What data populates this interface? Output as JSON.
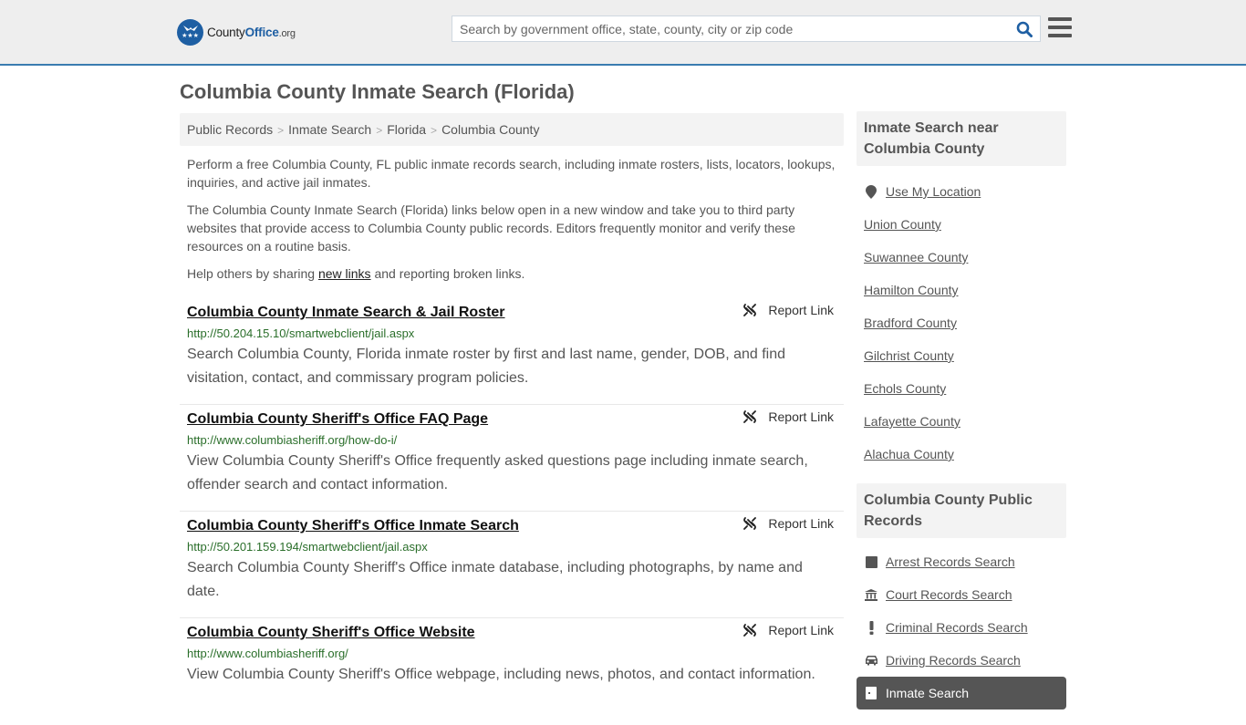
{
  "header": {
    "logo": {
      "text_main": "County",
      "text_accent": "Office",
      "text_suffix": ".org"
    },
    "search": {
      "placeholder": "Search by government office, state, county, city or zip code",
      "value": ""
    },
    "brand_color": "#1e5fa3"
  },
  "page": {
    "title": "Columbia County Inmate Search (Florida)"
  },
  "breadcrumb": [
    {
      "label": "Public Records"
    },
    {
      "label": "Inmate Search"
    },
    {
      "label": "Florida"
    },
    {
      "label": "Columbia County"
    }
  ],
  "intro": {
    "p1": "Perform a free Columbia County, FL public inmate records search, including inmate rosters, lists, locators, lookups, inquiries, and active jail inmates.",
    "p2": "The Columbia County Inmate Search (Florida) links below open in a new window and take you to third party websites that provide access to Columbia County public records. Editors frequently monitor and verify these resources on a routine basis.",
    "p3_before": "Help others by sharing ",
    "p3_link": "new links",
    "p3_after": " and reporting broken links."
  },
  "results": [
    {
      "title": "Columbia County Inmate Search & Jail Roster",
      "url": "http://50.204.15.10/smartwebclient/jail.aspx",
      "description": "Search Columbia County, Florida inmate roster by first and last name, gender, DOB, and find visitation, contact, and commissary program policies.",
      "report_label": "Report Link"
    },
    {
      "title": "Columbia County Sheriff's Office FAQ Page",
      "url": "http://www.columbiasheriff.org/how-do-i/",
      "description": "View Columbia County Sheriff's Office frequently asked questions page including inmate search, offender search and contact information.",
      "report_label": "Report Link"
    },
    {
      "title": "Columbia County Sheriff's Office Inmate Search",
      "url": "http://50.201.159.194/smartwebclient/jail.aspx",
      "description": "Search Columbia County Sheriff's Office inmate database, including photographs, by name and date.",
      "report_label": "Report Link"
    },
    {
      "title": "Columbia County Sheriff's Office Website",
      "url": "http://www.columbiasheriff.org/",
      "description": "View Columbia County Sheriff's Office webpage, including news, photos, and contact information.",
      "report_label": "Report Link"
    }
  ],
  "sidebar": {
    "nearby": {
      "heading": "Inmate Search near Columbia County",
      "use_location": {
        "label": "Use My Location",
        "icon": "map-pin-icon"
      },
      "items": [
        {
          "label": "Union County"
        },
        {
          "label": "Suwannee County"
        },
        {
          "label": "Hamilton County"
        },
        {
          "label": "Bradford County"
        },
        {
          "label": "Gilchrist County"
        },
        {
          "label": "Echols County"
        },
        {
          "label": "Lafayette County"
        },
        {
          "label": "Alachua County"
        }
      ]
    },
    "public_records": {
      "heading": "Columbia County Public Records",
      "items": [
        {
          "label": "Arrest Records Search",
          "icon": "book-icon"
        },
        {
          "label": "Court Records Search",
          "icon": "courthouse-icon"
        },
        {
          "label": "Criminal Records Search",
          "icon": "exclamation-icon"
        },
        {
          "label": "Driving Records Search",
          "icon": "car-icon"
        },
        {
          "label": "Inmate Search",
          "icon": "jail-door-icon",
          "active": true
        }
      ]
    }
  }
}
